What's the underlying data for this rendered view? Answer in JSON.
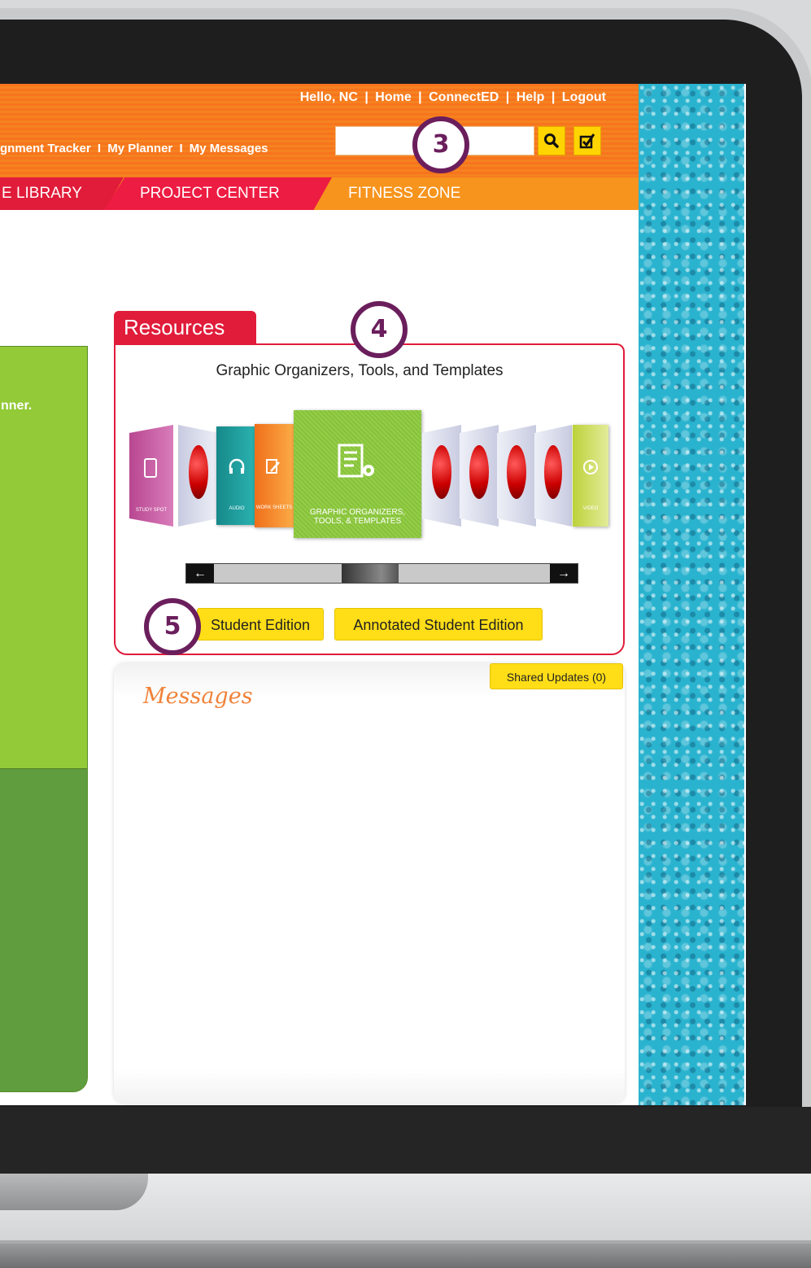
{
  "header": {
    "top_links": {
      "greeting": "Hello, NC",
      "home": "Home",
      "connected": "ConnectED",
      "help": "Help",
      "logout": "Logout",
      "separator": "|"
    },
    "sub_links": {
      "assignment_tracker": "gnment Tracker",
      "my_planner": "My Planner",
      "my_messages": "My Messages",
      "separator": "I"
    },
    "search_placeholder": ""
  },
  "nav": {
    "tabs": [
      {
        "label": "E LIBRARY"
      },
      {
        "label": "PROJECT CENTER"
      },
      {
        "label": "FITNESS ZONE"
      }
    ]
  },
  "left_panel": {
    "text": "nner."
  },
  "resources": {
    "tab_label": "Resources",
    "subtitle": "Graphic Organizers, Tools, and Templates",
    "carousel_items": [
      {
        "label": "STUDY SPOT",
        "icon": "mobile-icon",
        "color": "#c84e9a"
      },
      {
        "label": "",
        "icon": "red-drop-icon",
        "color": "#d6d9e8"
      },
      {
        "label": "AUDIO",
        "icon": "headphones-icon",
        "color": "#1d9b9a"
      },
      {
        "label": "WORK SHEETS",
        "icon": "edit-icon",
        "color": "#f58220"
      },
      {
        "label": "GRAPHIC ORGANIZERS, TOOLS, & TEMPLATES",
        "icon": "document-gear-icon",
        "color": "#8cc63f"
      },
      {
        "label": "",
        "icon": "red-drop-icon",
        "color": "#d6d9e8"
      },
      {
        "label": "",
        "icon": "red-drop-icon",
        "color": "#d6d9e8"
      },
      {
        "label": "",
        "icon": "red-drop-icon",
        "color": "#d6d9e8"
      },
      {
        "label": "",
        "icon": "red-drop-icon",
        "color": "#d6d9e8"
      },
      {
        "label": "VIDEO",
        "icon": "play-icon",
        "color": "#c7da4a"
      }
    ],
    "slider_left_glyph": "←",
    "slider_right_glyph": "→",
    "buttons": {
      "student_edition": "Student Edition",
      "annotated_student_edition": "Annotated Student Edition"
    }
  },
  "messages": {
    "title": "Messages",
    "shared_updates": "Shared Updates (0)"
  },
  "callouts": [
    "3",
    "4",
    "5"
  ],
  "colors": {
    "header_orange": "#f58220",
    "nav_red": "#e01c3a",
    "button_yellow": "#ffde17",
    "green_panel": "#8cc63f",
    "callout_purple": "#6b1e5c",
    "water_blue": "#2ab3cf"
  }
}
